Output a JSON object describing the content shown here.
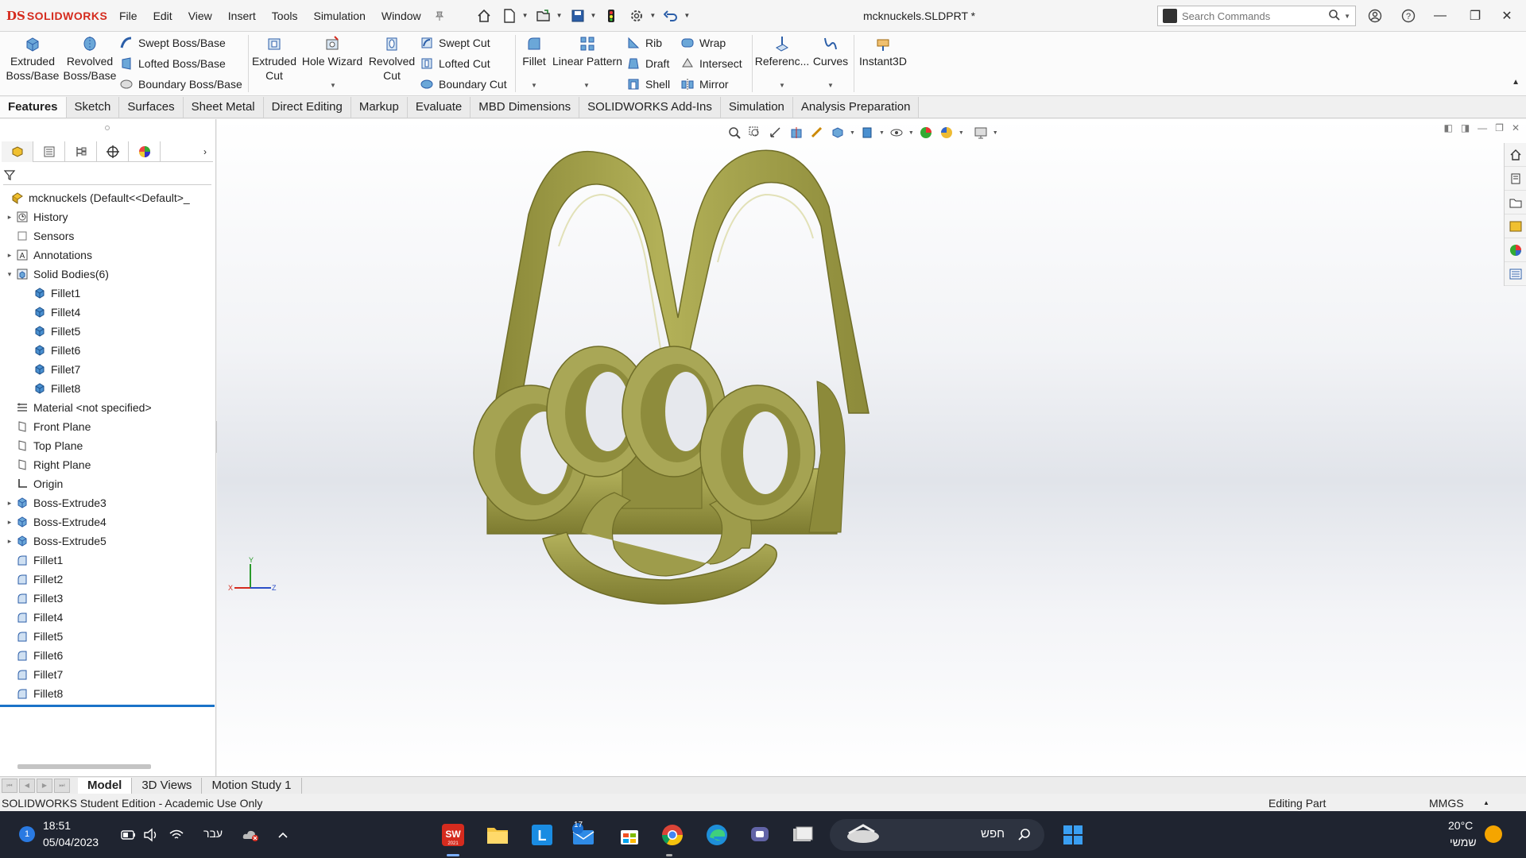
{
  "app": {
    "logo_mark": "DS",
    "logo_text": "SOLIDWORKS",
    "document_title": "mcknuckels.SLDPRT *",
    "menu": [
      "File",
      "Edit",
      "View",
      "Insert",
      "Tools",
      "Simulation",
      "Window"
    ],
    "search_placeholder": "Search Commands"
  },
  "ribbon": {
    "extruded_boss": "Extruded\nBoss/Base",
    "revolved_boss": "Revolved\nBoss/Base",
    "swept_boss": "Swept Boss/Base",
    "lofted_boss": "Lofted Boss/Base",
    "boundary_boss": "Boundary Boss/Base",
    "extruded_cut": "Extruded\nCut",
    "hole_wizard": "Hole Wizard",
    "revolved_cut": "Revolved\nCut",
    "swept_cut": "Swept Cut",
    "lofted_cut": "Lofted Cut",
    "boundary_cut": "Boundary Cut",
    "fillet": "Fillet",
    "linear_pattern": "Linear Pattern",
    "rib": "Rib",
    "draft": "Draft",
    "shell": "Shell",
    "wrap": "Wrap",
    "intersect": "Intersect",
    "mirror": "Mirror",
    "reference": "Referenc...",
    "curves": "Curves",
    "instant3d": "Instant3D"
  },
  "command_tabs": [
    "Features",
    "Sketch",
    "Surfaces",
    "Sheet Metal",
    "Direct Editing",
    "Markup",
    "Evaluate",
    "MBD Dimensions",
    "SOLIDWORKS Add-Ins",
    "Simulation",
    "Analysis Preparation"
  ],
  "feature_tree": {
    "root": "mcknuckels  (Default<<Default>_",
    "history": "History",
    "sensors": "Sensors",
    "annotations": "Annotations",
    "solid_bodies": "Solid Bodies(6)",
    "bodies": [
      "Fillet1",
      "Fillet4",
      "Fillet5",
      "Fillet6",
      "Fillet7",
      "Fillet8"
    ],
    "material": "Material <not specified>",
    "front_plane": "Front Plane",
    "top_plane": "Top Plane",
    "right_plane": "Right Plane",
    "origin": "Origin",
    "extrudes": [
      "Boss-Extrude3",
      "Boss-Extrude4",
      "Boss-Extrude5"
    ],
    "fillets": [
      "Fillet1",
      "Fillet2",
      "Fillet3",
      "Fillet4",
      "Fillet5",
      "Fillet6",
      "Fillet7",
      "Fillet8"
    ]
  },
  "triad": {
    "x": "X",
    "y": "Y",
    "z": "Z"
  },
  "bottom_tabs": [
    "Model",
    "3D Views",
    "Motion Study 1"
  ],
  "status": {
    "left": "SOLIDWORKS Student Edition - Academic Use Only",
    "mode": "Editing Part",
    "units": "MMGS"
  },
  "taskbar": {
    "time": "18:51",
    "date": "05/04/2023",
    "notif_count": "1",
    "lang": "עבר",
    "search_text": "חפש",
    "weather_temp": "20°C",
    "weather_desc": "שמשי",
    "mail_badge": "17",
    "sw_year": "2021"
  },
  "colors": {
    "model": "#a9a852",
    "model_dark": "#6f6d28",
    "accent_blue": "#1a73c8",
    "logo_red": "#d52b1e"
  }
}
